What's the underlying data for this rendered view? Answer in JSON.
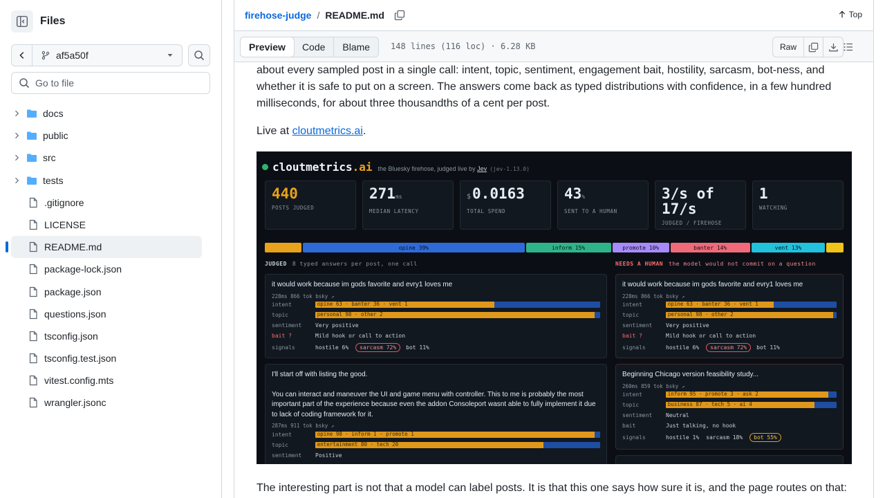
{
  "sidebar": {
    "title": "Files",
    "branch": "af5a50f",
    "goto_placeholder": "Go to file",
    "items": [
      {
        "label": "docs",
        "type": "dir"
      },
      {
        "label": "public",
        "type": "dir"
      },
      {
        "label": "src",
        "type": "dir"
      },
      {
        "label": "tests",
        "type": "dir"
      },
      {
        "label": ".gitignore",
        "type": "file"
      },
      {
        "label": "LICENSE",
        "type": "file"
      },
      {
        "label": "README.md",
        "type": "file",
        "selected": true
      },
      {
        "label": "package-lock.json",
        "type": "file"
      },
      {
        "label": "package.json",
        "type": "file"
      },
      {
        "label": "questions.json",
        "type": "file"
      },
      {
        "label": "tsconfig.json",
        "type": "file"
      },
      {
        "label": "tsconfig.test.json",
        "type": "file"
      },
      {
        "label": "vitest.config.mts",
        "type": "file"
      },
      {
        "label": "wrangler.jsonc",
        "type": "file"
      }
    ]
  },
  "header": {
    "repo": "firehose-judge",
    "separator": "/",
    "file": "README.md",
    "top_label": "Top"
  },
  "filebar": {
    "tabs": [
      "Preview",
      "Code",
      "Blame"
    ],
    "active_tab": "Preview",
    "info": "148 lines (116 loc) · 6.28 KB",
    "raw_label": "Raw"
  },
  "article": {
    "para1": "about every sampled post in a single call: intent, topic, sentiment, engagement bait, hostility, sarcasm, bot-ness, and whether it is safe to put on a screen. The answers come back as typed distributions with confidence, in a few hundred milliseconds, for about three thousandths of a cent per post.",
    "live_prefix": "Live at ",
    "live_link": "cloutmetrics.ai",
    "live_suffix": ".",
    "tail": "The interesting part is not that a model can label posts. It is that this one says how sure it is, and the page routes on that:"
  },
  "dashboard": {
    "brand": "cloutmetrics",
    "brand_suffix": ".ai",
    "tagline_prefix": "the Bluesky firehose, judged live by ",
    "tagline_link": "Jev",
    "version": "(jev-1.13.0)",
    "stats": [
      {
        "value": "440",
        "unit": "",
        "currency": "",
        "label": "POSTS JUDGED"
      },
      {
        "value": "271",
        "unit": "ms",
        "currency": "",
        "label": "MEDIAN LATENCY"
      },
      {
        "value": "0.0163",
        "unit": "",
        "currency": "$",
        "label": "TOTAL SPEND"
      },
      {
        "value": "43",
        "unit": "%",
        "currency": "",
        "label": "SENT TO A HUMAN"
      },
      {
        "value": "3/s of 17/s",
        "unit": "",
        "currency": "",
        "label": "JUDGED / FIREHOSE"
      },
      {
        "value": "1",
        "unit": "",
        "currency": "",
        "label": "WATCHING"
      }
    ],
    "distribution": [
      {
        "label": "",
        "share": 6.5,
        "color": "#e8a21b"
      },
      {
        "label": "opine 39%",
        "share": 39,
        "color": "#2f6bd8"
      },
      {
        "label": "inform 15%",
        "share": 15,
        "color": "#2fb48a"
      },
      {
        "label": "promote 10%",
        "share": 10,
        "color": "#a78bfa"
      },
      {
        "label": "banter 14%",
        "share": 14,
        "color": "#f06a7a"
      },
      {
        "label": "vent 13%",
        "share": 13,
        "color": "#22c1dc"
      },
      {
        "label": "",
        "share": 3,
        "color": "#f2c318"
      }
    ],
    "judged_head": "JUDGED",
    "judged_sub": "8 typed answers per post, one call",
    "human_head": "NEEDS A HUMAN",
    "human_sub": "the model would not commit on a question",
    "cards": [
      {
        "post": "it would work because im gods favorite and evry1 loves me",
        "meta": "228ms  866 tok  bsky ↗",
        "intent_text": "opine 63 · banter 36 · vent 1",
        "intent_share": 0.63,
        "topic_text": "personal 98 · other 2",
        "topic_share": 0.98,
        "sentiment": "Very positive",
        "bait_key": "bait ?",
        "bait": "Mild hook or call to action",
        "hostile": "hostile 6%",
        "sarcasm": "sarcasm 72%",
        "bot": "bot 11%"
      },
      {
        "post": "it would work because im gods favorite and evry1 loves me",
        "meta": "228ms  866 tok  bsky ↗",
        "intent_text": "opine 63 · banter 36 · vent 1",
        "intent_share": 0.63,
        "topic_text": "personal 98 · other 2",
        "topic_share": 0.98,
        "sentiment": "Very positive",
        "bait_key": "bait ?",
        "bait": "Mild hook or call to action",
        "hostile": "hostile 6%",
        "sarcasm": "sarcasm 72%",
        "bot": "bot 11%"
      },
      {
        "post1": "I'll start off with listing the good.",
        "post2": "You can interact and maneuver the UI and game menu with controller. This to me is probably the most important part of the experience because even the addon Consoleport wasnt able to fully implement it due to lack of coding framework for it.",
        "meta": "287ms  911 tok  bsky ↗",
        "intent_text": "opine 98 · inform 1 · promote 1",
        "intent_share": 0.98,
        "topic_text": "entertainment 80 · tech 20",
        "topic_share": 0.8,
        "sentiment": "Positive"
      },
      {
        "post": "Beginning Chicago version feasibility study...",
        "meta": "260ms  859 tok  bsky ↗",
        "intent_text": "inform 95 · promote 3 · ask 2",
        "intent_share": 0.95,
        "topic_text": "business 87 · tech 5 · ai 4",
        "topic_share": 0.87,
        "sentiment": "Neutral",
        "bait_key": "bait",
        "bait": "Just talking, no hook",
        "hostile": "hostile 1%",
        "sarcasm": "sarcasm 18%",
        "bot": "bot 55%"
      }
    ],
    "labels": {
      "intent": "intent",
      "topic": "topic",
      "sentiment": "sentiment",
      "signals": "signals"
    }
  }
}
